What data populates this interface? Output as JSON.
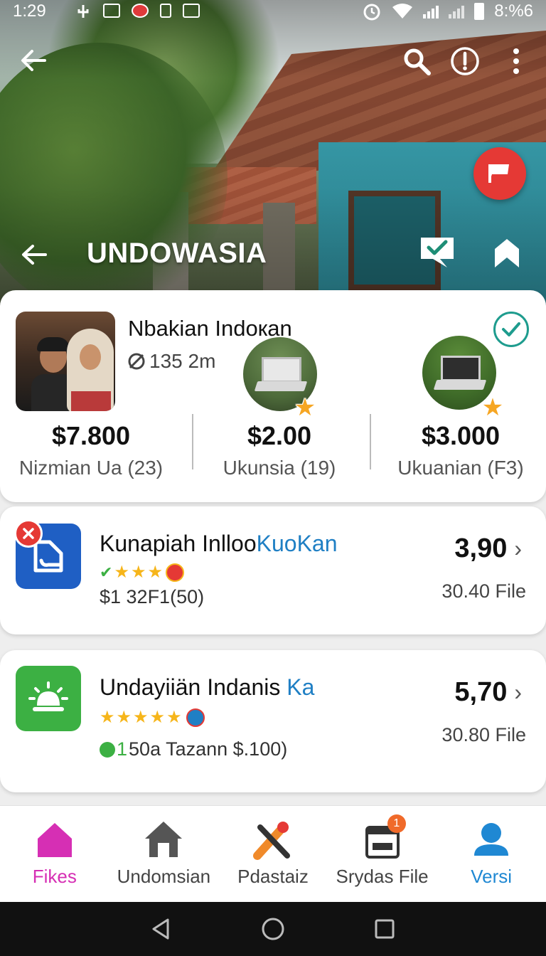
{
  "status_bar": {
    "time": "1:29",
    "battery_text": "8:%6"
  },
  "header": {
    "title": "UNDOWASIA"
  },
  "profile": {
    "name": "Nbakian Indoкan",
    "subtitle": "135 2m",
    "stats": [
      {
        "value": "$7.800",
        "label": "Nizmian Ua (23)"
      },
      {
        "value": "$2.00",
        "label": "Ukunsia (19)"
      },
      {
        "value": "$3.000",
        "label": "Ukuanian (F3)"
      }
    ]
  },
  "listings": [
    {
      "title_main": "Kunapiah Inlloo",
      "title_accent": "KuoKan",
      "meta": "$1 32F1(50)",
      "price": "3,90",
      "file": "30.40 File",
      "stars": 3,
      "icon_color": "#1f5fc4"
    },
    {
      "title_main": "Undayiiän Indanis ",
      "title_accent": "Ka",
      "meta_prefix": "1",
      "meta": "50a Tazann $.100)",
      "price": "5,70",
      "file": "30.80 File",
      "stars": 5,
      "icon_color": "#3cb043"
    }
  ],
  "bottom_nav": [
    {
      "label": "Fikes",
      "icon": "home-icon",
      "color": "#d62fb4"
    },
    {
      "label": "Undomsian",
      "icon": "house-icon",
      "color": "#444444"
    },
    {
      "label": "Pdastaiz",
      "icon": "tools-icon",
      "color": "#444444"
    },
    {
      "label": "Srydas File",
      "icon": "calendar-icon",
      "color": "#444444",
      "badge": "1"
    },
    {
      "label": "Versi",
      "icon": "profile-icon",
      "color": "#1f88d3"
    }
  ],
  "colors": {
    "accent_pink": "#d62fb4",
    "accent_blue": "#1f88d3",
    "verified_teal": "#1e9c8e",
    "flag_red": "#e53935"
  }
}
